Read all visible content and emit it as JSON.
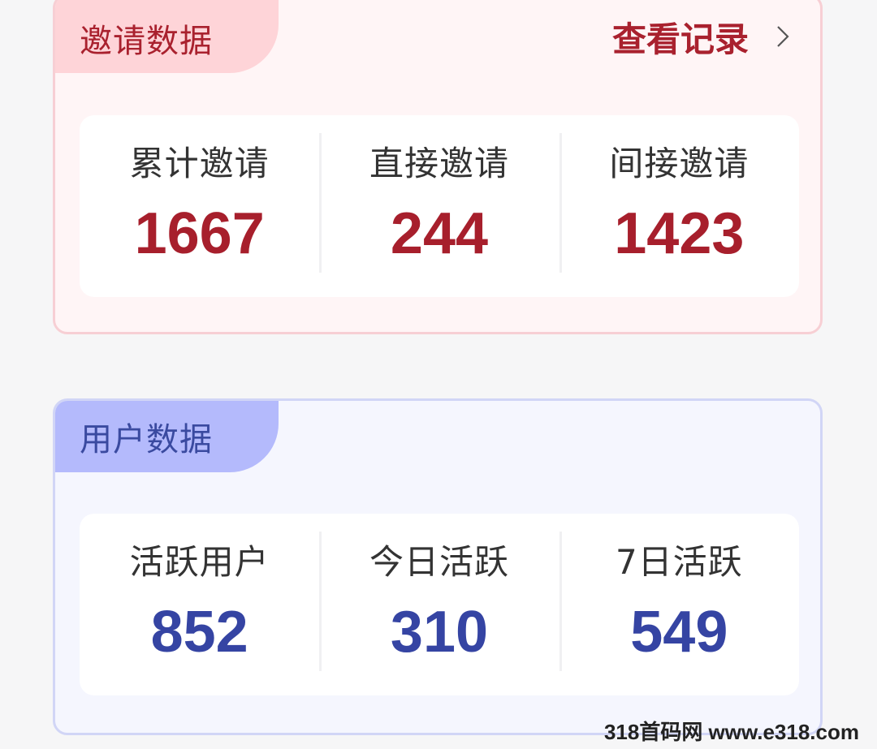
{
  "invite": {
    "title": "邀请数据",
    "view_records": "查看记录",
    "stats": [
      {
        "label": "累计邀请",
        "value": "1667"
      },
      {
        "label": "直接邀请",
        "value": "244"
      },
      {
        "label": "间接邀请",
        "value": "1423"
      }
    ]
  },
  "user": {
    "title": "用户数据",
    "stats": [
      {
        "label": "活跃用户",
        "value": "852"
      },
      {
        "label": "今日活跃",
        "value": "310"
      },
      {
        "label": "7日活跃",
        "value": "549"
      }
    ]
  },
  "watermark": "318首码网 www.e318.com",
  "colors": {
    "invite_accent": "#a9212e",
    "user_accent": "#3544a3"
  },
  "icons": {
    "view_records": "chevron-right-icon"
  }
}
